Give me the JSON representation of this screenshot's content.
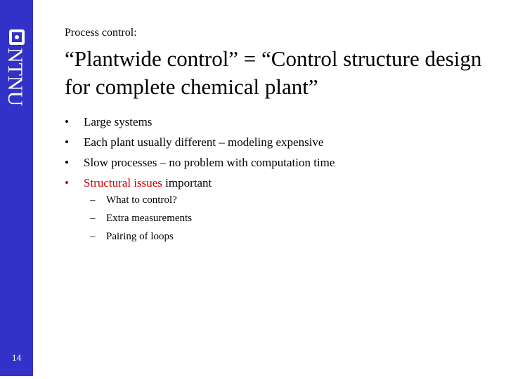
{
  "sidebar": {
    "logo_text": "NTNU",
    "page_number": "14"
  },
  "slide": {
    "subtitle": "Process control:",
    "title": "“Plantwide control” = “Control structure design for complete chemical plant”",
    "bullets": [
      {
        "marker": "•",
        "text": "Large systems",
        "highlight": ""
      },
      {
        "marker": "•",
        "text": "Each plant usually different – modeling expensive",
        "highlight": ""
      },
      {
        "marker": "•",
        "text": "Slow processes – no problem with computation time",
        "highlight": ""
      },
      {
        "marker": "•",
        "text": " important",
        "highlight": "Structural issues"
      }
    ],
    "sub_bullets": [
      {
        "marker": "–",
        "text": "What to control?"
      },
      {
        "marker": "–",
        "text": "Extra measurements"
      },
      {
        "marker": "–",
        "text": "Pairing of loops"
      }
    ]
  },
  "colors": {
    "sidebar": "#3232c8",
    "highlight": "#cc0000"
  }
}
